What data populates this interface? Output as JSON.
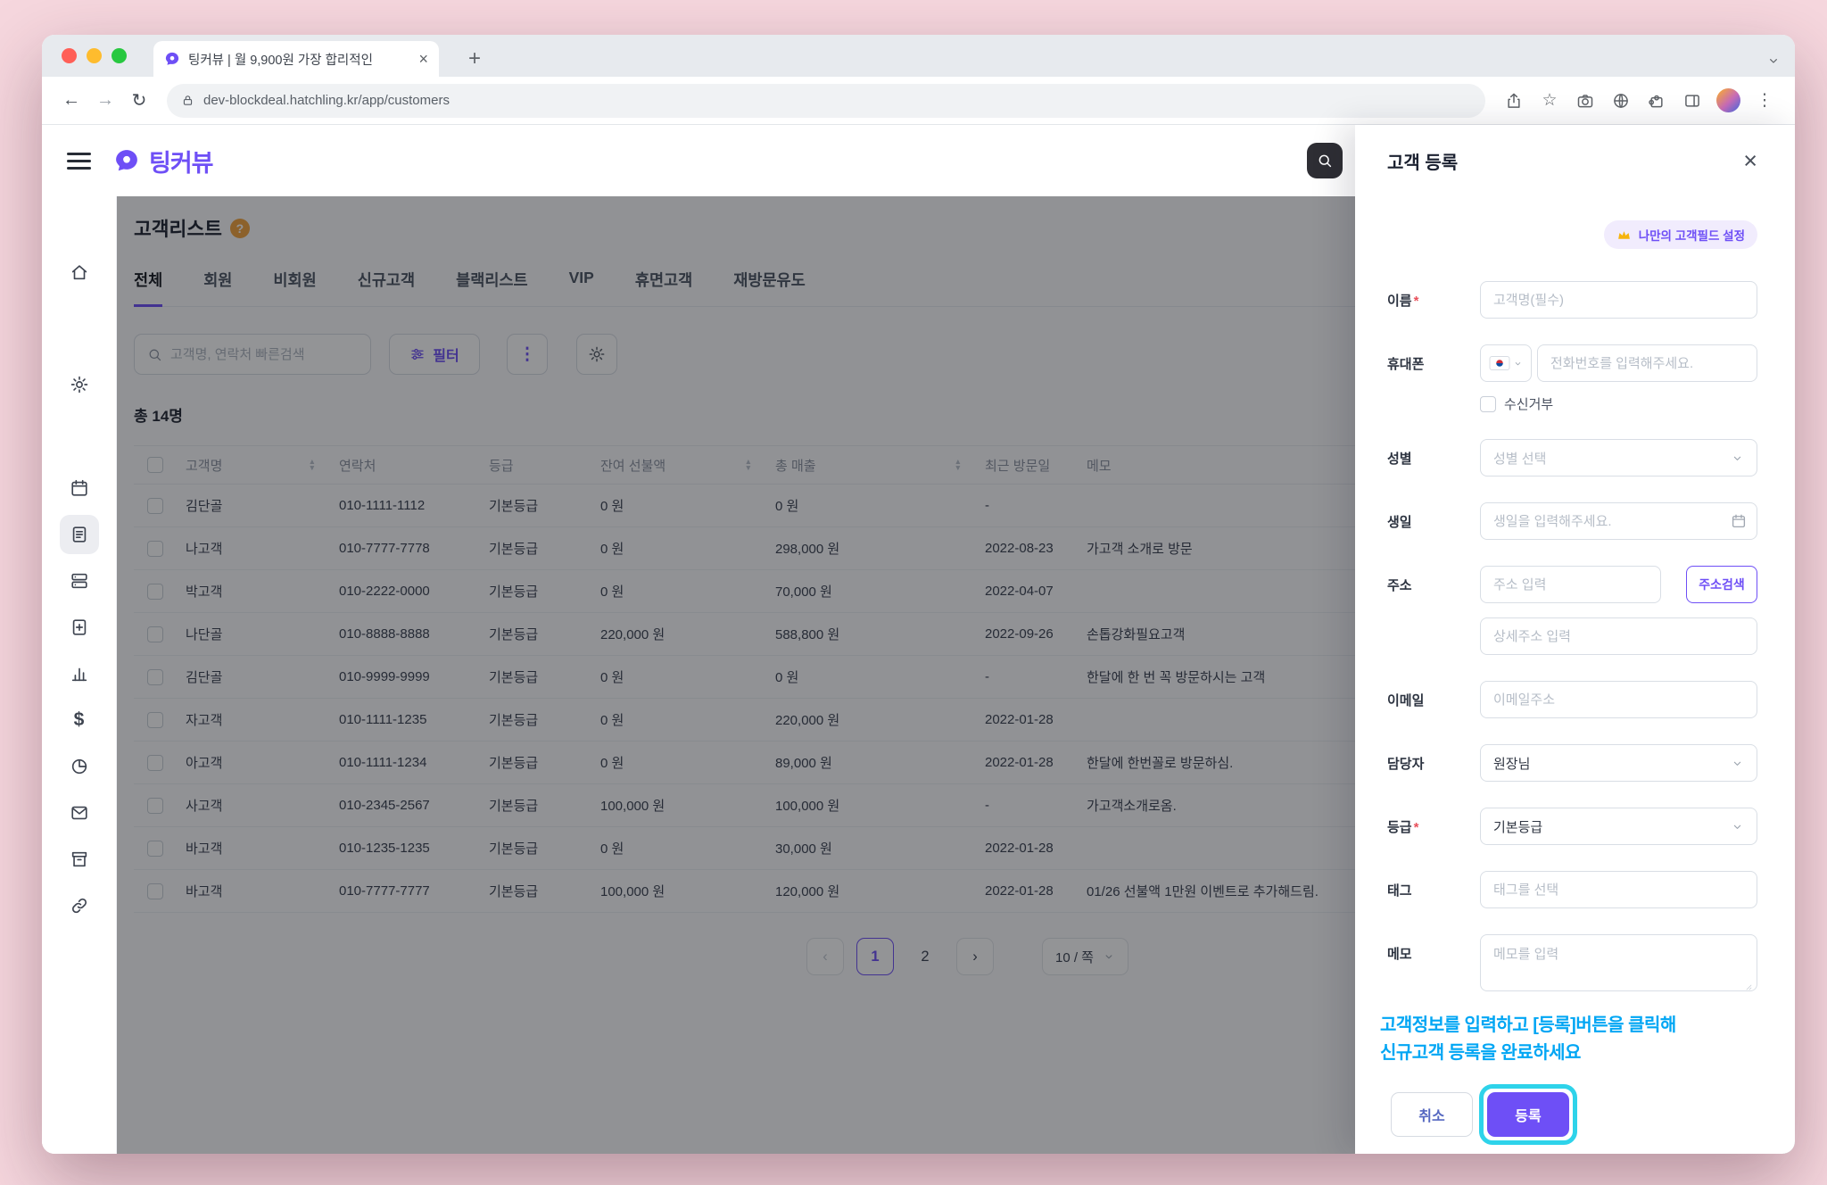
{
  "colors": {
    "accent": "#6e4ff6",
    "highlight_ring": "#2ed3ea",
    "coach_text": "#00a6f4",
    "frame": "#f6d7de"
  },
  "browser": {
    "tab_title": "팅커뷰 | 월 9,900원 가장 합리적인",
    "url": "dev-blockdeal.hatchling.kr/app/customers"
  },
  "icons": {
    "back": "←",
    "forward": "→",
    "reload": "↻",
    "close": "×",
    "new_tab": "+",
    "menu": "⋮",
    "star": "☆",
    "prev": "‹",
    "next": "›",
    "sort_up": "▲",
    "sort_down": "▼",
    "dollar": "$"
  },
  "header": {
    "logo": "팅커뷰"
  },
  "page": {
    "title": "고객리스트",
    "help_badge": "?",
    "tabs": [
      "전체",
      "회원",
      "비회원",
      "신규고객",
      "블랙리스트",
      "VIP",
      "휴면고객",
      "재방문유도"
    ],
    "search_placeholder": "고객명, 연락처 빠른검색",
    "filter_label": "필터",
    "total_label": "총 14명",
    "table": {
      "columns": [
        "고객명",
        "연락처",
        "등급",
        "잔여 선불액",
        "총 매출",
        "최근 방문일",
        "메모"
      ],
      "rows": [
        {
          "name": "김단골",
          "phone": "010-1111-1112",
          "grade": "기본등급",
          "balance": "0 원",
          "sales": "0 원",
          "visit": "-",
          "memo": ""
        },
        {
          "name": "나고객",
          "phone": "010-7777-7778",
          "grade": "기본등급",
          "balance": "0 원",
          "sales": "298,000 원",
          "visit": "2022-08-23",
          "memo": "가고객 소개로 방문"
        },
        {
          "name": "박고객",
          "phone": "010-2222-0000",
          "grade": "기본등급",
          "balance": "0 원",
          "sales": "70,000 원",
          "visit": "2022-04-07",
          "memo": ""
        },
        {
          "name": "나단골",
          "phone": "010-8888-8888",
          "grade": "기본등급",
          "balance": "220,000 원",
          "sales": "588,800 원",
          "visit": "2022-09-26",
          "memo": "손톱강화필요고객"
        },
        {
          "name": "김단골",
          "phone": "010-9999-9999",
          "grade": "기본등급",
          "balance": "0 원",
          "sales": "0 원",
          "visit": "-",
          "memo": "한달에 한 번 꼭 방문하시는 고객"
        },
        {
          "name": "자고객",
          "phone": "010-1111-1235",
          "grade": "기본등급",
          "balance": "0 원",
          "sales": "220,000 원",
          "visit": "2022-01-28",
          "memo": ""
        },
        {
          "name": "아고객",
          "phone": "010-1111-1234",
          "grade": "기본등급",
          "balance": "0 원",
          "sales": "89,000 원",
          "visit": "2022-01-28",
          "memo": "한달에 한번꼴로 방문하심."
        },
        {
          "name": "사고객",
          "phone": "010-2345-2567",
          "grade": "기본등급",
          "balance": "100,000 원",
          "sales": "100,000 원",
          "visit": "-",
          "memo": "가고객소개로옴."
        },
        {
          "name": "바고객",
          "phone": "010-1235-1235",
          "grade": "기본등급",
          "balance": "0 원",
          "sales": "30,000 원",
          "visit": "2022-01-28",
          "memo": ""
        },
        {
          "name": "바고객",
          "phone": "010-7777-7777",
          "grade": "기본등급",
          "balance": "100,000 원",
          "sales": "120,000 원",
          "visit": "2022-01-28",
          "memo": "01/26 선불액 1만원 이벤트로 추가해드림."
        }
      ]
    },
    "pagination": {
      "page_1": "1",
      "page_2": "2",
      "page_size": "10 / 쪽"
    }
  },
  "drawer": {
    "title": "고객 등록",
    "field_settings_label": "나만의 고객필드 설정",
    "required_mark": "*",
    "name": {
      "label": "이름",
      "placeholder": "고객명(필수)"
    },
    "phone": {
      "label": "휴대폰",
      "placeholder": "전화번호를 입력해주세요.",
      "optout_label": "수신거부"
    },
    "gender": {
      "label": "성별",
      "placeholder": "성별 선택"
    },
    "birthday": {
      "label": "생일",
      "placeholder": "생일을 입력해주세요."
    },
    "address": {
      "label": "주소",
      "placeholder": "주소 입력",
      "search_button": "주소검색",
      "detail_placeholder": "상세주소 입력"
    },
    "email": {
      "label": "이메일",
      "placeholder": "이메일주소"
    },
    "manager": {
      "label": "담당자",
      "value": "원장님"
    },
    "grade": {
      "label": "등급",
      "value": "기본등급"
    },
    "tag": {
      "label": "태그",
      "placeholder": "태그를 선택"
    },
    "memo": {
      "label": "메모",
      "placeholder": "메모를 입력"
    },
    "coach_line1": "고객정보를 입력하고 [등록]버튼을 클릭해",
    "coach_line2": "신규고객 등록을 완료하세요",
    "cancel_label": "취소",
    "submit_label": "등록"
  }
}
